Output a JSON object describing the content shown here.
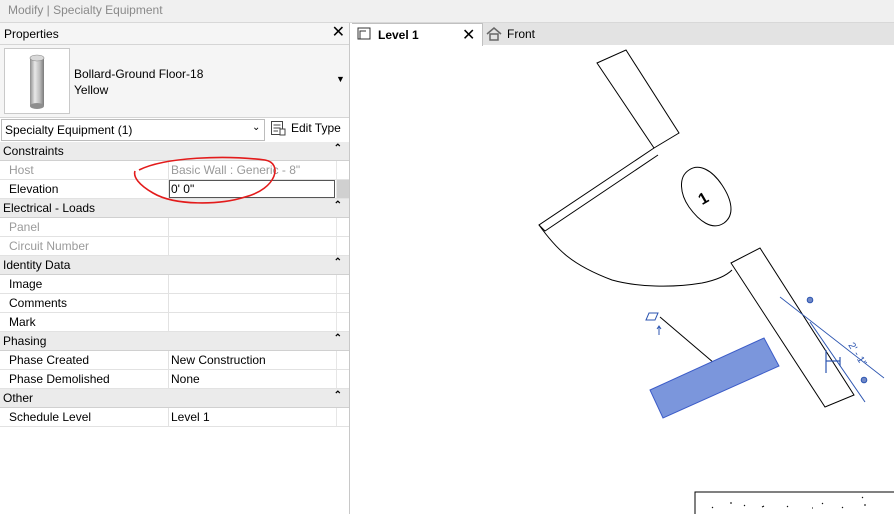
{
  "window": {
    "title": "Modify | Specialty Equipment"
  },
  "properties": {
    "title": "Properties",
    "close_label": "✕",
    "type_name": "Bollard-Ground Floor-18",
    "type_sub": "Yellow",
    "selector_value": "Specialty Equipment (1)",
    "edit_type_label": "Edit Type",
    "categories": [
      {
        "name": "Constraints",
        "rows": [
          {
            "name": "Host",
            "value": "Basic Wall : Generic - 8\""
          },
          {
            "name": "Elevation",
            "value": "0'  0\""
          }
        ]
      },
      {
        "name": "Electrical - Loads",
        "rows": [
          {
            "name": "Panel",
            "value": ""
          },
          {
            "name": "Circuit Number",
            "value": ""
          }
        ]
      },
      {
        "name": "Identity Data",
        "rows": [
          {
            "name": "Image",
            "value": ""
          },
          {
            "name": "Comments",
            "value": ""
          },
          {
            "name": "Mark",
            "value": ""
          }
        ]
      },
      {
        "name": "Phasing",
        "rows": [
          {
            "name": "Phase Created",
            "value": "New Construction"
          },
          {
            "name": "Phase Demolished",
            "value": "None"
          }
        ]
      },
      {
        "name": "Other",
        "rows": [
          {
            "name": "Schedule Level",
            "value": "Level 1"
          }
        ]
      }
    ]
  },
  "view": {
    "tabs": [
      {
        "label": "Level 1",
        "icon": "floor-plan-icon"
      },
      {
        "label": "Front",
        "icon": "elevation-house-icon"
      }
    ],
    "tag_number": "1",
    "dimension": "2' - 1\""
  },
  "colors": {
    "selected_fill": "#7b96dc",
    "selected_stroke": "#3c5cc8",
    "dimension": "#2c55b0",
    "annotation": "#e31b1b"
  }
}
